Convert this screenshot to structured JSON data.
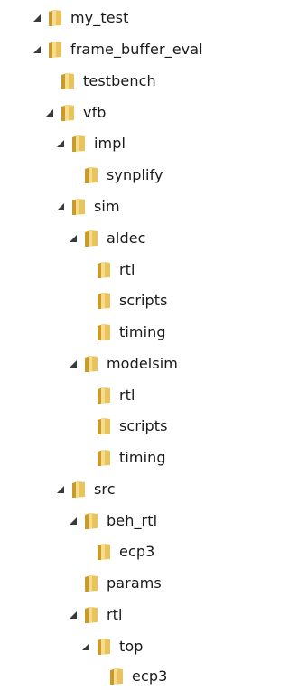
{
  "tree": {
    "root": {
      "label": "my_test",
      "frame_buffer_eval": {
        "label": "frame_buffer_eval",
        "testbench": {
          "label": "testbench"
        },
        "vfb": {
          "label": "vfb",
          "impl": {
            "label": "impl",
            "synplify": {
              "label": "synplify"
            }
          },
          "sim": {
            "label": "sim",
            "aldec": {
              "label": "aldec",
              "rtl": {
                "label": "rtl"
              },
              "scripts": {
                "label": "scripts"
              },
              "timing": {
                "label": "timing"
              }
            },
            "modelsim": {
              "label": "modelsim",
              "rtl": {
                "label": "rtl"
              },
              "scripts": {
                "label": "scripts"
              },
              "timing": {
                "label": "timing"
              }
            }
          },
          "src": {
            "label": "src",
            "beh_rtl": {
              "label": "beh_rtl",
              "ecp3": {
                "label": "ecp3"
              }
            },
            "params": {
              "label": "params"
            },
            "rtl": {
              "label": "rtl",
              "top": {
                "label": "top",
                "ecp3": {
                  "label": "ecp3"
                }
              }
            }
          }
        }
      }
    }
  },
  "colors": {
    "folder_light": "#f7dc8a",
    "folder_mid": "#e9c35c",
    "folder_dark": "#c99a2e",
    "toggle": "#3a3a3a",
    "text": "#1a1a1a"
  },
  "icons": {
    "folder": "folder-icon",
    "expanded_toggle": "expand-triangle-icon"
  }
}
